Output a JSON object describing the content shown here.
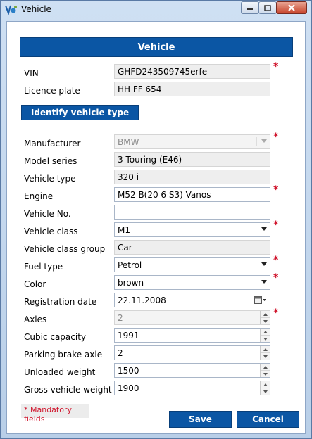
{
  "window": {
    "title": "Vehicle"
  },
  "header": {
    "title": "Vehicle"
  },
  "fields": {
    "vin": {
      "label": "VIN",
      "value": "GHFD243509745erfe"
    },
    "licence_plate": {
      "label": "Licence plate",
      "value": "HH FF 654"
    },
    "manufacturer": {
      "label": "Manufacturer",
      "value": "BMW"
    },
    "model_series": {
      "label": "Model series",
      "value": "3 Touring (E46)"
    },
    "vehicle_type": {
      "label": "Vehicle type",
      "value": "320 i"
    },
    "engine": {
      "label": "Engine",
      "value": "M52 B(20 6 S3) Vanos"
    },
    "vehicle_no": {
      "label": "Vehicle No.",
      "value": ""
    },
    "vehicle_class": {
      "label": "Vehicle class",
      "value": "M1"
    },
    "vehicle_class_group": {
      "label": "Vehicle class group",
      "value": "Car"
    },
    "fuel_type": {
      "label": "Fuel type",
      "value": "Petrol"
    },
    "color": {
      "label": "Color",
      "value": "brown"
    },
    "registration_date": {
      "label": "Registration date",
      "value": "22.11.2008"
    },
    "axles": {
      "label": "Axles",
      "value": "2"
    },
    "cubic_capacity": {
      "label": "Cubic capacity",
      "value": "1991"
    },
    "parking_brake_axle": {
      "label": "Parking brake axle",
      "value": "2"
    },
    "unloaded_weight": {
      "label": "Unloaded weight",
      "value": "1500"
    },
    "gross_vehicle_weight": {
      "label": "Gross vehicle weight",
      "value": "1900"
    }
  },
  "buttons": {
    "identify": "Identify vehicle type",
    "save": "Save",
    "cancel": "Cancel"
  },
  "required_marker": "*",
  "mandatory_note": "* Mandatory fields",
  "colors": {
    "accent": "#0b56a4",
    "required": "#d0142c"
  }
}
